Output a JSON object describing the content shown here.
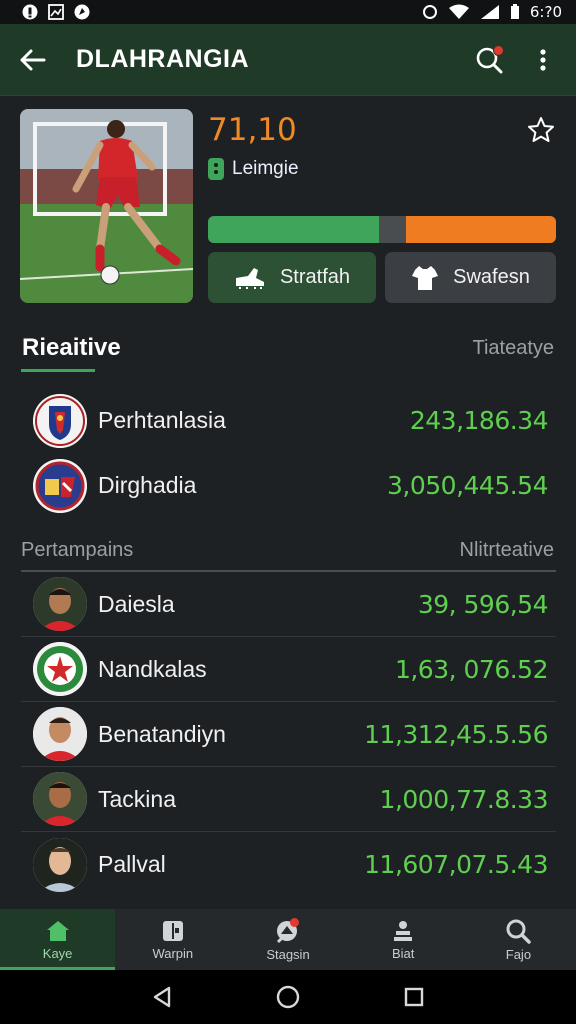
{
  "status_bar": {
    "time": "6:?0"
  },
  "app_bar": {
    "title": "DLAHRANGIA"
  },
  "profile": {
    "score": "71,10",
    "league": "Leimgie",
    "bar_green_fraction": 0.49,
    "bar_gap_fraction": 0.08,
    "buttons": [
      {
        "label": "Stratfah",
        "icon": "cleat-icon"
      },
      {
        "label": "Swafesn",
        "icon": "jersey-icon"
      }
    ]
  },
  "section1": {
    "title": "Rieaitive",
    "right_label": "Tiateatye",
    "rows": [
      {
        "name": "Perhtanlasia",
        "value": "243,186.34",
        "avatar": "club-crest-shield"
      },
      {
        "name": "Dirghadia",
        "value": "3,050,445.54",
        "avatar": "club-crest-round"
      }
    ]
  },
  "section2": {
    "left_label": "Pertampains",
    "right_label": "Nlitrteative",
    "rows": [
      {
        "name": "Daiesla",
        "value": "39, 596,54",
        "avatar": "player-portrait"
      },
      {
        "name": "Nandkalas",
        "value": "1,63, 076.52",
        "avatar": "club-crest-star"
      },
      {
        "name": "Benatandiyn",
        "value": "11,312,45.5.56",
        "avatar": "player-portrait"
      },
      {
        "name": "Tackina",
        "value": "1,000,77.8.33",
        "avatar": "player-portrait"
      },
      {
        "name": "Pallval",
        "value": "11,607,07.5.43",
        "avatar": "player-portrait"
      }
    ]
  },
  "bottom_nav": [
    {
      "label": "Kaye",
      "icon": "home-icon",
      "active": true
    },
    {
      "label": "Warpin",
      "icon": "jersey-icon",
      "active": false
    },
    {
      "label": "Stagsin",
      "icon": "stadium-icon",
      "active": false
    },
    {
      "label": "Biat",
      "icon": "person-icon",
      "active": false
    },
    {
      "label": "Fajo",
      "icon": "search-icon",
      "active": false
    }
  ],
  "colors": {
    "accent": "#3fa55b",
    "orange": "#f07c22",
    "appbar": "#1f3a27",
    "value_green": "#5fcf4f"
  }
}
